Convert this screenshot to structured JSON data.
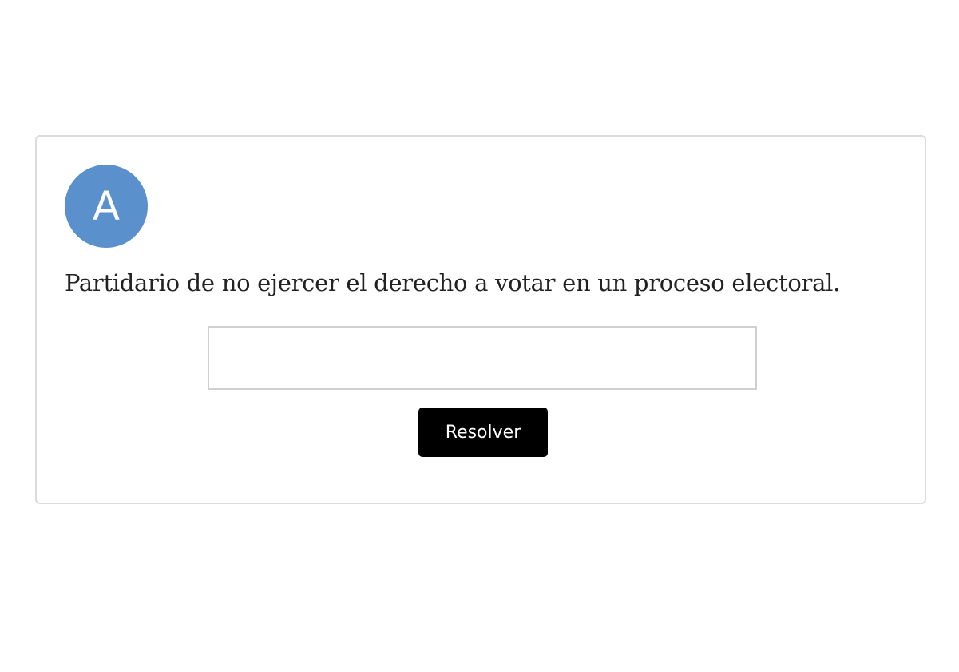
{
  "badge": {
    "letter": "A",
    "color": "#5a90cc"
  },
  "clue": {
    "text": "Partidario de no ejercer el derecho a votar en un proceso electoral."
  },
  "answer": {
    "value": "",
    "placeholder": ""
  },
  "resolve_button": {
    "label": "Resolver",
    "background": "#000000"
  }
}
